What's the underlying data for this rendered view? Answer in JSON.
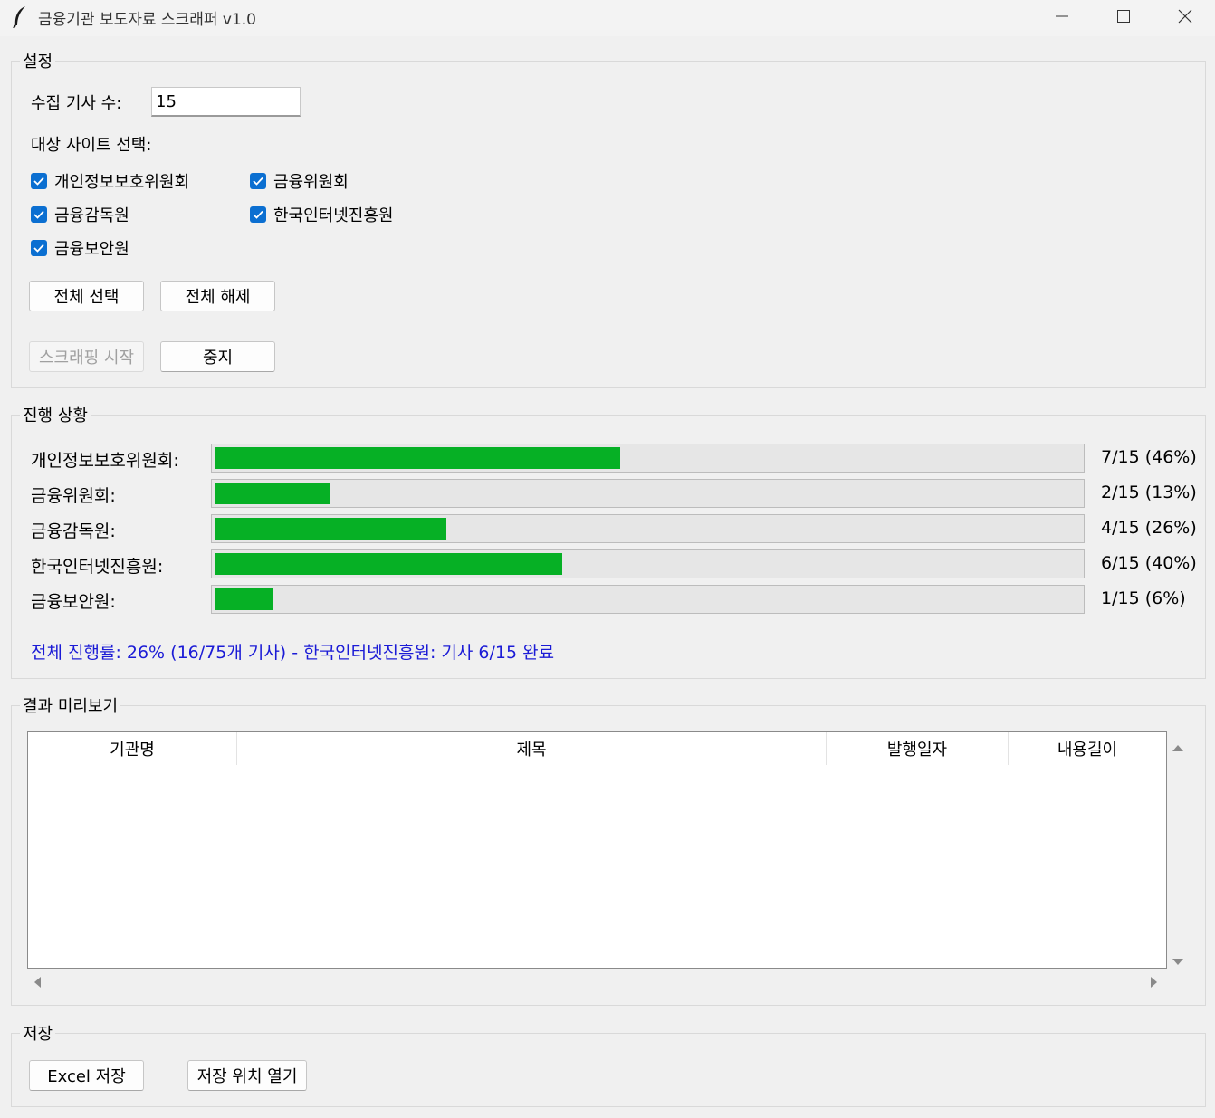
{
  "window": {
    "title": "금융기관 보도자료 스크래퍼 v1.0"
  },
  "settings": {
    "group_label": "설정",
    "count_label": "수집 기사 수:",
    "count_value": "15",
    "sites_label": "대상 사이트 선택:",
    "sites": [
      {
        "label": "개인정보보호위원회",
        "checked": true
      },
      {
        "label": "금융위원회",
        "checked": true
      },
      {
        "label": "금융감독원",
        "checked": true
      },
      {
        "label": "한국인터넷진흥원",
        "checked": true
      },
      {
        "label": "금융보안원",
        "checked": true
      }
    ],
    "select_all_label": "전체 선택",
    "deselect_all_label": "전체 해제",
    "start_label": "스크래핑 시작",
    "stop_label": "중지"
  },
  "progress": {
    "group_label": "진행 상황",
    "rows": [
      {
        "label": "개인정보보호위원회:",
        "fraction": 0.4667,
        "text": "7/15 (46%)"
      },
      {
        "label": "금융위원회:",
        "fraction": 0.1333,
        "text": "2/15 (13%)"
      },
      {
        "label": "금융감독원:",
        "fraction": 0.2667,
        "text": "4/15 (26%)"
      },
      {
        "label": "한국인터넷진흥원:",
        "fraction": 0.4,
        "text": "6/15 (40%)"
      },
      {
        "label": "금융보안원:",
        "fraction": 0.0667,
        "text": "1/15 (6%)"
      }
    ],
    "overall_text": "전체 진행률: 26% (16/75개 기사) - 한국인터넷진흥원: 기사 6/15 완료",
    "bar_color": "#06b025",
    "overall_color": "#1b1bd6"
  },
  "results": {
    "group_label": "결과 미리보기",
    "columns": [
      "기관명",
      "제목",
      "발행일자",
      "내용길이"
    ],
    "rows": []
  },
  "save": {
    "group_label": "저장",
    "excel_label": "Excel 저장",
    "open_folder_label": "저장 위치 열기"
  }
}
